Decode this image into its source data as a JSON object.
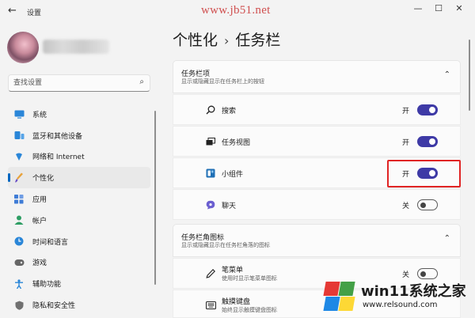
{
  "window": {
    "title": "设置",
    "watermark": "www.jb51.net",
    "controls": {
      "minimize": "—",
      "maximize": "☐",
      "close": "✕"
    }
  },
  "sidebar": {
    "search_placeholder": "查找设置",
    "items": [
      {
        "label": "系统",
        "icon": "monitor-icon",
        "color": "#2a86d8"
      },
      {
        "label": "蓝牙和其他设备",
        "icon": "bluetooth-devices-icon",
        "color": "#2a86d8"
      },
      {
        "label": "网络和 Internet",
        "icon": "wifi-icon",
        "color": "#2a86d8"
      },
      {
        "label": "个性化",
        "icon": "brush-icon",
        "color": "#e8a23a",
        "active": true
      },
      {
        "label": "应用",
        "icon": "apps-icon",
        "color": "#3f7cd6"
      },
      {
        "label": "帐户",
        "icon": "account-icon",
        "color": "#2e9e64"
      },
      {
        "label": "时间和语言",
        "icon": "globe-clock-icon",
        "color": "#2a86d8"
      },
      {
        "label": "游戏",
        "icon": "gamepad-icon",
        "color": "#666666"
      },
      {
        "label": "辅助功能",
        "icon": "accessibility-icon",
        "color": "#2a86d8"
      },
      {
        "label": "隐私和安全性",
        "icon": "shield-icon",
        "color": "#707070"
      }
    ]
  },
  "breadcrumb": {
    "parent": "个性化",
    "separator": "›",
    "current": "任务栏"
  },
  "sections": {
    "taskbar_items": {
      "title": "任务栏项",
      "subtitle": "显示或隐藏显示在任务栏上的按钮",
      "rows": [
        {
          "label": "搜索",
          "state": "开",
          "on": true,
          "icon": "search-icon"
        },
        {
          "label": "任务视图",
          "state": "开",
          "on": true,
          "icon": "task-view-icon"
        },
        {
          "label": "小组件",
          "state": "开",
          "on": true,
          "icon": "widgets-icon"
        },
        {
          "label": "聊天",
          "state": "关",
          "on": false,
          "icon": "chat-icon"
        }
      ]
    },
    "corner_icons": {
      "title": "任务栏角图标",
      "subtitle": "显示或隐藏显示在任务栏角落的图标",
      "rows": [
        {
          "label": "笔菜单",
          "sub": "使用时显示笔菜单图标",
          "state": "关",
          "on": false,
          "icon": "pen-icon"
        },
        {
          "label": "触摸键盘",
          "sub": "始终显示触摸键盘图标",
          "icon": "keyboard-icon"
        }
      ]
    }
  },
  "brand_watermark": {
    "title": "win11系统之家",
    "url": "www.relsound.com",
    "colors": [
      "#e53935",
      "#43a047",
      "#1e88e5",
      "#fdd835"
    ]
  },
  "colors": {
    "accent": "#3e3aa6",
    "highlight_box": "#e02424",
    "active_nav_bar": "#0067c0"
  }
}
